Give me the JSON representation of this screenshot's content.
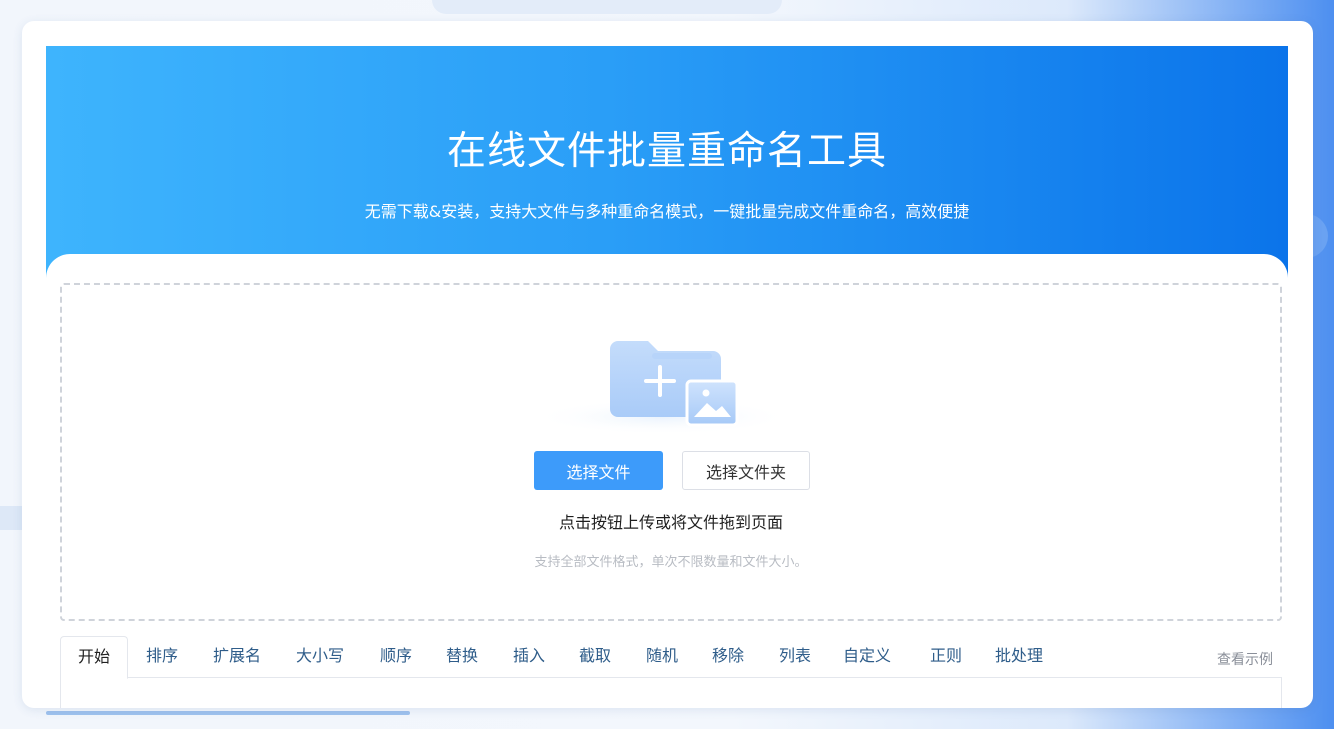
{
  "hero": {
    "title": "在线文件批量重命名工具",
    "subtitle": "无需下载&安装，支持大文件与多种重命名模式，一键批量完成文件重命名，高效便捷"
  },
  "upload": {
    "illustration_icon": "folder-add-image-icon",
    "select_files_label": "选择文件",
    "select_folder_label": "选择文件夹",
    "hint": "点击按钮上传或将文件拖到页面",
    "sub_hint": "支持全部文件格式，单次不限数量和文件大小。"
  },
  "tabs": [
    {
      "label": "开始",
      "active": true
    },
    {
      "label": "排序"
    },
    {
      "label": "扩展名"
    },
    {
      "label": "大小写"
    },
    {
      "label": "顺序"
    },
    {
      "label": "替换"
    },
    {
      "label": "插入"
    },
    {
      "label": "截取"
    },
    {
      "label": "随机"
    },
    {
      "label": "移除"
    },
    {
      "label": "列表"
    },
    {
      "label": "自定义"
    },
    {
      "label": "正则"
    },
    {
      "label": "批处理"
    }
  ],
  "example_link": "查看示例",
  "colors": {
    "primary": "#3d9bfa",
    "hero_start": "#3eb4fd",
    "hero_end": "#0b74ea",
    "tab_text": "#2f5d8a"
  }
}
